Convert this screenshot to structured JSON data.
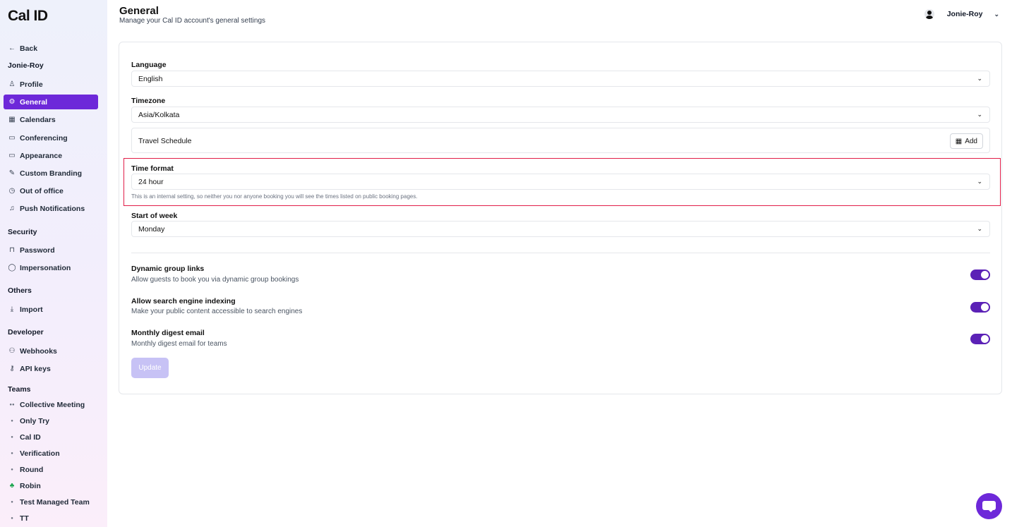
{
  "app": {
    "logo": "Cal ID"
  },
  "sidebar": {
    "back": "Back",
    "account_head": "Jonie-Roy",
    "account_items": [
      {
        "label": "Profile",
        "icon": "user-icon"
      },
      {
        "label": "General",
        "icon": "gear-icon",
        "active": true
      },
      {
        "label": "Calendars",
        "icon": "calendar-icon"
      },
      {
        "label": "Conferencing",
        "icon": "video-icon"
      },
      {
        "label": "Appearance",
        "icon": "monitor-icon"
      },
      {
        "label": "Custom Branding",
        "icon": "brush-icon"
      },
      {
        "label": "Out of office",
        "icon": "clock-icon"
      },
      {
        "label": "Push Notifications",
        "icon": "bell-icon"
      }
    ],
    "security_head": "Security",
    "security_items": [
      {
        "label": "Password",
        "icon": "lock-icon"
      },
      {
        "label": "Impersonation",
        "icon": "shield-icon"
      }
    ],
    "others_head": "Others",
    "others_items": [
      {
        "label": "Import",
        "icon": "download-icon"
      }
    ],
    "developer_head": "Developer",
    "developer_items": [
      {
        "label": "Webhooks",
        "icon": "webhook-icon"
      },
      {
        "label": "API keys",
        "icon": "key-icon"
      }
    ],
    "teams_head": "Teams",
    "teams_items": [
      {
        "label": "Collective Meeting",
        "icon": "team-logo-icon"
      },
      {
        "label": "Only Try",
        "icon": "team-logo-icon"
      },
      {
        "label": "Cal ID",
        "icon": "team-logo-icon"
      },
      {
        "label": "Verification",
        "icon": "team-logo-icon"
      },
      {
        "label": "Round",
        "icon": "team-logo-icon"
      },
      {
        "label": "Robin",
        "icon": "team-logo-icon"
      },
      {
        "label": "Test Managed Team",
        "icon": "team-logo-icon"
      },
      {
        "label": "TT",
        "icon": "team-logo-icon"
      }
    ]
  },
  "header": {
    "title": "General",
    "subtitle": "Manage your Cal ID account's general settings",
    "user_name": "Jonie-Roy"
  },
  "form": {
    "language_label": "Language",
    "language_value": "English",
    "timezone_label": "Timezone",
    "timezone_value": "Asia/Kolkata",
    "travel_schedule_label": "Travel Schedule",
    "add_label": "Add",
    "time_format_label": "Time format",
    "time_format_value": "24 hour",
    "time_format_hint": "This is an internal setting, so neither you nor anyone booking you will see the times listed on public booking pages.",
    "start_of_week_label": "Start of week",
    "start_of_week_value": "Monday",
    "toggles": [
      {
        "title": "Dynamic group links",
        "desc": "Allow guests to book you via dynamic group bookings",
        "on": true
      },
      {
        "title": "Allow search engine indexing",
        "desc": "Make your public content accessible to search engines",
        "on": true
      },
      {
        "title": "Monthly digest email",
        "desc": "Monthly digest email for teams",
        "on": true
      }
    ],
    "update_label": "Update"
  },
  "colors": {
    "accent": "#6d28d9",
    "toggle_on": "#5b21b6",
    "highlight_border": "#e11d48",
    "update_disabled": "#c7c2f5"
  }
}
